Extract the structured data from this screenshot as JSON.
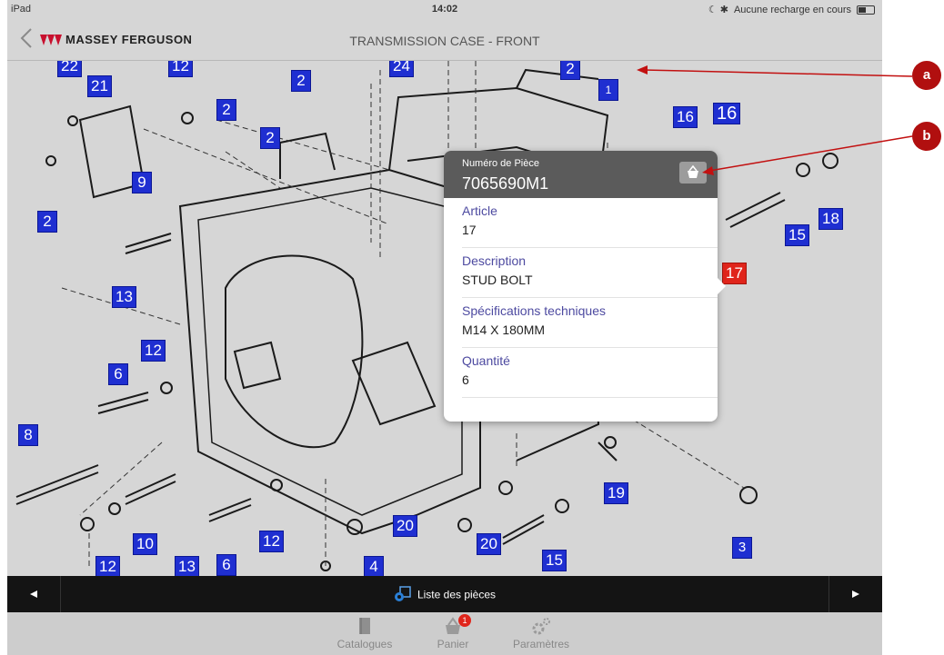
{
  "status_bar": {
    "carrier": "iPad",
    "time": "14:02",
    "battery_text": "Aucune recharge en cours"
  },
  "nav": {
    "brand": "MASSEY FERGUSON",
    "title": "TRANSMISSION CASE - FRONT"
  },
  "diagram": {
    "labels": [
      "22",
      "21",
      "12",
      "2",
      "2",
      "2",
      "24",
      "2",
      "1",
      "16",
      "16",
      "9",
      "2",
      "18",
      "15",
      "17",
      "13",
      "12",
      "6",
      "8",
      "10",
      "13",
      "6",
      "12",
      "20",
      "20",
      "19",
      "3",
      "12",
      "4",
      "15"
    ]
  },
  "popover": {
    "part_number_label": "Numéro de Pièce",
    "part_number": "7065690M1",
    "rows": [
      {
        "label": "Article",
        "value": "17"
      },
      {
        "label": "Description",
        "value": "STUD BOLT"
      },
      {
        "label": "Spécifications techniques",
        "value": "M14 X 180MM"
      },
      {
        "label": "Quantité",
        "value": "6"
      }
    ]
  },
  "toolbar": {
    "center_label": "Liste des pièces"
  },
  "tabbar": {
    "tabs": [
      {
        "label": "Catalogues",
        "icon": "book-icon"
      },
      {
        "label": "Panier",
        "icon": "basket-icon",
        "badge": "1"
      },
      {
        "label": "Paramètres",
        "icon": "gear-icon"
      }
    ]
  },
  "callouts": [
    "a",
    "b"
  ],
  "colors": {
    "tag_blue": "#1f2fd1",
    "tag_selected": "#e0251b",
    "callout_red": "#b10f0f"
  }
}
